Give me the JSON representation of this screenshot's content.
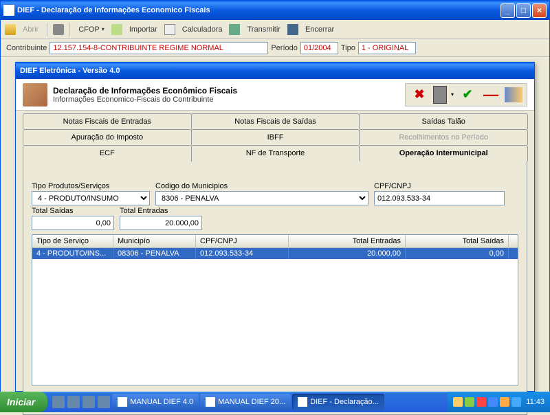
{
  "main_window": {
    "title": "DIEF - Declaração de Informações Economico Fiscais"
  },
  "toolbar": {
    "abrir": "Abrir",
    "cfop": "CFOP",
    "importar": "Importar",
    "calculadora": "Calculadora",
    "transmitir": "Transmitir",
    "encerrar": "Encerrar"
  },
  "header_fields": {
    "contribuinte_label": "Contribuinte",
    "contribuinte_value": "12.157.154-8-CONTRIBUINTE REGIME NORMAL",
    "periodo_label": "Período",
    "periodo_value": "01/2004",
    "tipo_label": "Tipo",
    "tipo_value": "1 - ORIGINAL"
  },
  "inner_window": {
    "titlebar": "DIEF Eletrônica - Versão 4.0",
    "title1": "Declaração de Informações Econômico Fiscais",
    "title2": "Informações Economico-Fiscais do Contribuinte"
  },
  "tabs": {
    "row1": [
      "Notas Fiscais de Entradas",
      "Notas Fiscais de Saídas",
      "Saídas Talão"
    ],
    "row2": [
      "Apuração do Imposto",
      "IBFF",
      "Recolhimentos no Período"
    ],
    "row3": [
      "ECF",
      "NF de Transporte",
      "Operação Intermunicipal"
    ]
  },
  "form": {
    "tipo_prod_label": "Tipo Produtos/Serviços",
    "tipo_prod_value": "4 - PRODUTO/INSUMO",
    "municipio_label": "Codigo do Municipios",
    "municipio_value": "8306 - PENALVA",
    "cpf_label": "CPF/CNPJ",
    "cpf_value": "012.093.533-34",
    "total_saidas_label": "Total Saídas",
    "total_saidas_value": "0,00",
    "total_entradas_label": "Total Entradas",
    "total_entradas_value": "20.000,00"
  },
  "grid": {
    "headers": [
      "Tipo de Serviço",
      "Municipío",
      "CPF/CNPJ",
      "Total Entradas",
      "Total Saídas"
    ],
    "row": {
      "tipo": "4 - PRODUTO/INS...",
      "municipio": "08306 - PENALVA",
      "cpf": "012.093.533-34",
      "entradas": "20.000,00",
      "saidas": "0,00"
    }
  },
  "taskbar": {
    "start": "Iniciar",
    "items": [
      "MANUAL DIEF 4.0",
      "MANUAL DIEF 20...",
      "DIEF - Declaração..."
    ],
    "clock": "11:43"
  }
}
